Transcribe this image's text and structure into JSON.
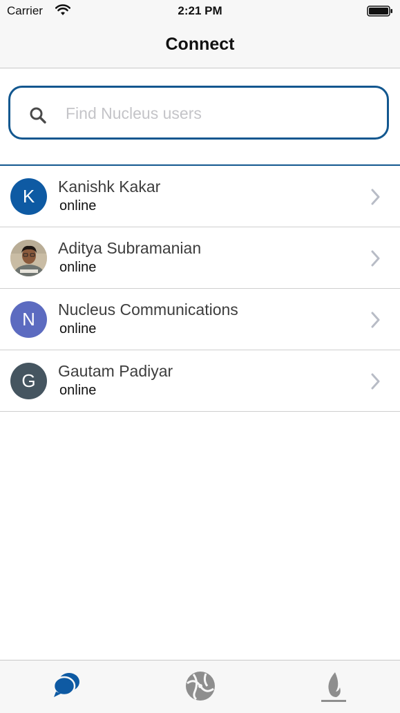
{
  "status_bar": {
    "carrier": "Carrier",
    "time": "2:21 PM"
  },
  "nav": {
    "title": "Connect"
  },
  "search": {
    "placeholder": "Find Nucleus users",
    "value": ""
  },
  "contacts": [
    {
      "name": "Kanishk Kakar",
      "status": "online",
      "initial": "K",
      "avatar_color": "#0e5aa3",
      "avatar_type": "initial"
    },
    {
      "name": "Aditya Subramanian",
      "status": "online",
      "initial": "",
      "avatar_color": "#9c8466",
      "avatar_type": "photo"
    },
    {
      "name": "Nucleus Communications",
      "status": "online",
      "initial": "N",
      "avatar_color": "#5c6bc0",
      "avatar_type": "initial"
    },
    {
      "name": "Gautam Padiyar",
      "status": "online",
      "initial": "G",
      "avatar_color": "#455560",
      "avatar_type": "initial"
    }
  ],
  "tabs": [
    {
      "icon": "chat-bubbles-icon",
      "active": true,
      "color": "#0e5aa3"
    },
    {
      "icon": "globe-icon",
      "active": false,
      "color": "#8e8e8e"
    },
    {
      "icon": "flame-icon",
      "active": false,
      "color": "#8e8e8e"
    }
  ],
  "colors": {
    "accent": "#12578f",
    "chevron": "#b8bcc6"
  }
}
